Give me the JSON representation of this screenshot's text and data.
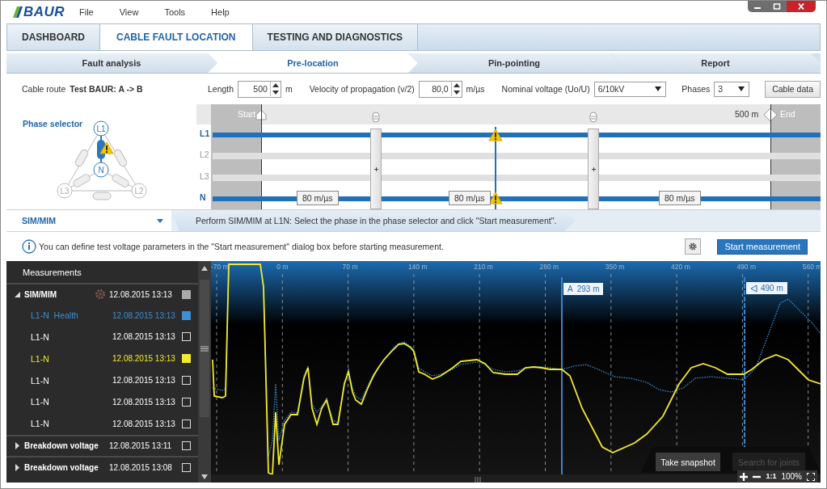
{
  "window": {
    "logo": "BAUR",
    "menu": [
      "File",
      "View",
      "Tools",
      "Help"
    ]
  },
  "main_tabs": [
    {
      "label": "DASHBOARD",
      "selected": false
    },
    {
      "label": "CABLE FAULT LOCATION",
      "selected": true
    },
    {
      "label": "TESTING AND DIAGNOSTICS",
      "selected": false
    }
  ],
  "steps": [
    {
      "label": "Fault analysis",
      "selected": false
    },
    {
      "label": "Pre-location",
      "selected": true
    },
    {
      "label": "Pin-pointing",
      "selected": false
    },
    {
      "label": "Report",
      "selected": false
    }
  ],
  "cable_route": {
    "label": "Cable route",
    "value": "Test BAUR: A -> B"
  },
  "params": {
    "length": {
      "label": "Length",
      "value": "500",
      "unit": "m"
    },
    "velocity": {
      "label": "Velocity of propagation  (v/2)",
      "value": "80,0",
      "unit": "m/µs"
    },
    "voltage": {
      "label": "Nominal voltage (Uo/U)",
      "value": "6/10kV"
    },
    "phases": {
      "label": "Phases",
      "value": "3"
    },
    "cable_data_button": "Cable data"
  },
  "phase_selector": {
    "title": "Phase selector",
    "nodes": [
      {
        "label": "L1",
        "selected": true
      },
      {
        "label": "N",
        "selected": true
      },
      {
        "label": "L3",
        "selected": false
      },
      {
        "label": "L2",
        "selected": false
      }
    ]
  },
  "cable_diagram": {
    "start_label": "Start",
    "end_distance": "500 m",
    "end_label": "End",
    "phases": [
      {
        "label": "L1",
        "active": true
      },
      {
        "label": "L2",
        "active": false
      },
      {
        "label": "L3",
        "active": false
      },
      {
        "label": "N",
        "active": true
      }
    ],
    "velocities": [
      "80 m/µs",
      "80 m/µs",
      "80 m/µs"
    ]
  },
  "method": {
    "label": "SIM/MIM",
    "instruction": "Perform SIM/MIM at L1N: Select the phase in the phase selector and click \"Start measurement\"."
  },
  "info": "You can define test voltage parameters in the \"Start measurement\" dialog box before starting measurement.",
  "start_button": "Start measurement",
  "measurements": {
    "title": "Measurements",
    "groups": [
      {
        "name": "SIM/MIM",
        "date": "12.08.2015 13:13",
        "checked": true,
        "expanded": true,
        "children": [
          {
            "name": "L1-N  Health",
            "date": "12.08.2015 13:13",
            "checked": true,
            "color": "#3b8fd4"
          },
          {
            "name": "L1-N",
            "date": "12.08.2015 13:13",
            "checked": false,
            "color": "#ffffff"
          },
          {
            "name": "L1-N",
            "date": "12.08.2015 13:13",
            "checked": true,
            "color": "#f2ea2e"
          },
          {
            "name": "L1-N",
            "date": "12.08.2015 13:13",
            "checked": false,
            "color": "#ffffff"
          },
          {
            "name": "L1-N",
            "date": "12.08.2015 13:13",
            "checked": false,
            "color": "#ffffff"
          },
          {
            "name": "L1-N",
            "date": "12.08.2015 13:13",
            "checked": false,
            "color": "#ffffff"
          }
        ]
      },
      {
        "name": "Breakdown voltage",
        "date": "12.08.2015 13:11",
        "checked": false,
        "expanded": false
      },
      {
        "name": "Breakdown voltage",
        "date": "12.08.2015 13:08",
        "checked": false,
        "expanded": false
      }
    ]
  },
  "chart": {
    "axis_labels": [
      "-70 m",
      "0 m",
      "70 m",
      "140 m",
      "210 m",
      "280 m",
      "350 m",
      "420 m",
      "490 m",
      "560 m"
    ],
    "cursors": [
      {
        "label": "A  293 m",
        "kind": "marker"
      },
      {
        "label": "490 m",
        "kind": "end"
      }
    ],
    "buttons": [
      {
        "label": "Take snapshot",
        "disabled": false
      },
      {
        "label": "Search for joints",
        "disabled": true
      }
    ],
    "zoom": {
      "reset": "1:1",
      "level": "100%"
    }
  }
}
